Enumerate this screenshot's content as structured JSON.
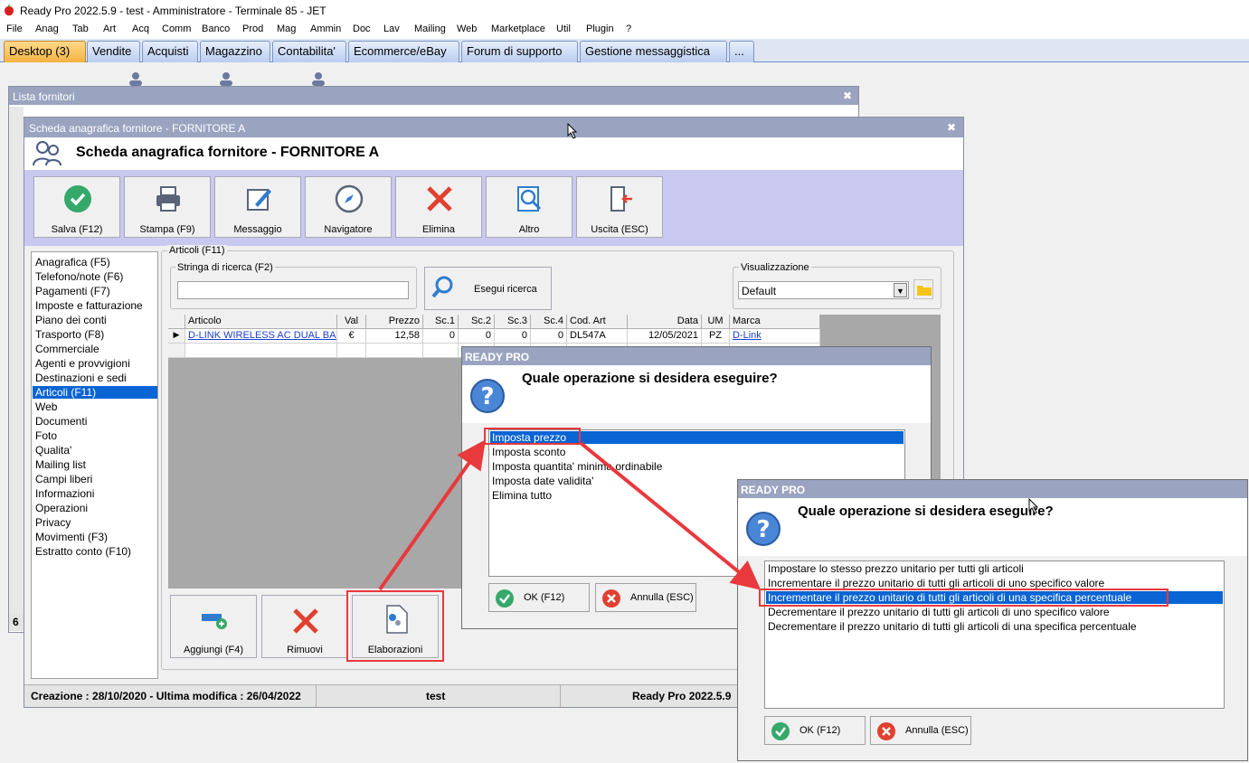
{
  "app": {
    "title": "Ready Pro 2022.5.9 - test - Amministratore - Terminale 85 - JET"
  },
  "menu": [
    "File",
    "Anag",
    "Tab",
    "Art",
    "Acq",
    "Comm",
    "Banco",
    "Prod",
    "Mag",
    "Ammin",
    "Doc",
    "Lav",
    "Mailing",
    "Web",
    "Marketplace",
    "Util",
    "Plugin",
    "?"
  ],
  "tabs": [
    "Desktop (3)",
    "Vendite",
    "Acquisti",
    "Magazzino",
    "Contabilita'",
    "Ecommerce/eBay",
    "Forum di supporto",
    "Gestione messaggistica",
    "..."
  ],
  "lista_window": {
    "title": "Lista fornitori",
    "status_fragment": "6"
  },
  "scheda_window": {
    "title": "Scheda anagrafica fornitore - FORNITORE A",
    "heading": "Scheda anagrafica fornitore - FORNITORE A",
    "toolbar": [
      {
        "label": "Salva (F12)",
        "icon": "check-icon"
      },
      {
        "label": "Stampa (F9)",
        "icon": "printer-icon"
      },
      {
        "label": "Messaggio",
        "icon": "message-edit-icon"
      },
      {
        "label": "Navigatore",
        "icon": "compass-icon"
      },
      {
        "label": "Elimina",
        "icon": "delete-x-icon"
      },
      {
        "label": "Altro",
        "icon": "magnifier-doc-icon"
      },
      {
        "label": "Uscita (ESC)",
        "icon": "exit-door-icon"
      }
    ],
    "nav": [
      "Anagrafica (F5)",
      "Telefono/note (F6)",
      "Pagamenti (F7)",
      "Imposte e fatturazione",
      "Piano dei conti",
      "Trasporto (F8)",
      "Commerciale",
      "Agenti e provvigioni",
      "Destinazioni e sedi",
      "Articoli (F11)",
      "Web",
      "Documenti",
      "Foto",
      "Qualita'",
      "Mailing list",
      "Campi liberi",
      "Informazioni",
      "Operazioni",
      "Privacy",
      "Movimenti (F3)",
      "Estratto conto (F10)"
    ],
    "nav_selected": "Articoli (F11)",
    "articoli_label": "Articoli (F11)",
    "search": {
      "label": "Stringa di ricerca (F2)",
      "value": "",
      "button": "Esegui ricerca"
    },
    "visualizzazione": {
      "label": "Visualizzazione",
      "value": "Default"
    },
    "grid": {
      "columns": [
        "Articolo",
        "Val",
        "Prezzo",
        "Sc.1",
        "Sc.2",
        "Sc.3",
        "Sc.4",
        "Cod. Art",
        "Data",
        "UM",
        "Marca"
      ],
      "rows": [
        [
          "D-LINK WIRELESS AC DUAL BA...",
          "€",
          "12,58",
          "0",
          "0",
          "0",
          "0",
          "DL547A",
          "12/05/2021",
          "PZ",
          "D-Link"
        ]
      ]
    },
    "bottom_buttons": [
      {
        "label": "Aggiungi (F4)"
      },
      {
        "label": "Rimuovi"
      },
      {
        "label": "Elaborazioni"
      }
    ],
    "status": {
      "left": "Creazione : 28/10/2020 - Ultima modifica : 26/04/2022",
      "middle": "test",
      "right": "Ready Pro 2022.5.9"
    }
  },
  "dialog1": {
    "title": "READY PRO",
    "question": "Quale operazione si desidera eseguire?",
    "options": [
      "Imposta prezzo",
      "Imposta sconto",
      "Imposta quantita' minima ordinabile",
      "Imposta date validita'",
      "Elimina tutto"
    ],
    "selected": "Imposta prezzo",
    "ok": "OK (F12)",
    "cancel": "Annulla (ESC)"
  },
  "dialog2": {
    "title": "READY PRO",
    "question": "Quale operazione si desidera eseguire?",
    "options": [
      "Impostare lo stesso prezzo unitario per tutti gli articoli",
      "Incrementare il prezzo unitario di tutti gli articoli di uno specifico valore",
      "Incrementare il prezzo unitario di tutti gli articoli di una specifica percentuale",
      "Decrementare il prezzo unitario di tutti gli articoli di uno specifico valore",
      "Decrementare il prezzo unitario di tutti gli articoli di una specifica percentuale"
    ],
    "selected": "Incrementare il prezzo unitario di tutti gli articoli di una specifica percentuale",
    "ok": "OK (F12)",
    "cancel": "Annulla (ESC)"
  },
  "colors": {
    "highlight": "#e8393d",
    "selection": "#0a64d3",
    "titlebar": "#9aa4c0",
    "toolband": "#c8c8f0"
  }
}
